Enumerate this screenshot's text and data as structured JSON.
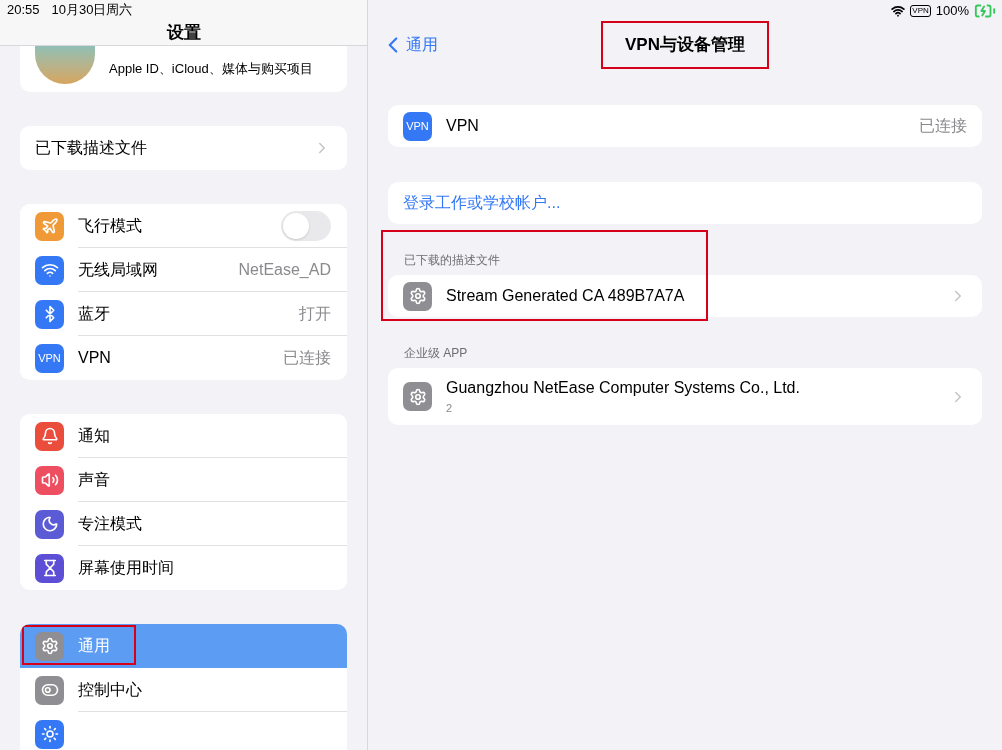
{
  "status_bar": {
    "time": "20:55",
    "date": "10月30日周六",
    "vpn": "VPN",
    "battery": "100%"
  },
  "sidebar": {
    "title": "设置",
    "account": {
      "subtitle": "Apple ID、iCloud、媒体与购买项目"
    },
    "groups": [
      {
        "items": [
          {
            "kind": "link",
            "label": "已下载描述文件",
            "selected": false,
            "annotated": false
          }
        ]
      },
      {
        "items": [
          {
            "kind": "toggle",
            "label": "飞行模式",
            "on": false,
            "selected": false,
            "annotated": false
          },
          {
            "kind": "value",
            "label": "无线局域网",
            "value": "NetEase_AD",
            "selected": false,
            "annotated": false
          },
          {
            "kind": "value",
            "label": "蓝牙",
            "value": "打开",
            "selected": false,
            "annotated": false
          },
          {
            "kind": "value",
            "icon_text": "VPN",
            "label": "VPN",
            "value": "已连接",
            "selected": false,
            "annotated": false
          }
        ]
      },
      {
        "items": [
          {
            "kind": "plain",
            "label": "通知",
            "selected": false,
            "annotated": false
          },
          {
            "kind": "plain",
            "label": "声音",
            "selected": false,
            "annotated": false
          },
          {
            "kind": "plain",
            "label": "专注模式",
            "selected": false,
            "annotated": false
          },
          {
            "kind": "plain",
            "label": "屏幕使用时间",
            "selected": false,
            "annotated": false
          }
        ]
      },
      {
        "items": [
          {
            "kind": "plain",
            "label": "通用",
            "selected": true,
            "annotated": true
          },
          {
            "kind": "plain",
            "label": "控制中心",
            "selected": false,
            "annotated": false
          },
          {
            "kind": "cut",
            "selected": false,
            "annotated": false
          }
        ]
      }
    ]
  },
  "detail": {
    "back": "通用",
    "title": "VPN与设备管理",
    "title_annotated": true,
    "sections": [
      {
        "annotated": false,
        "rows": [
          {
            "icon_text": "VPN",
            "label": "VPN",
            "value": "已连接",
            "chevron": false,
            "kind": "value"
          }
        ]
      },
      {
        "annotated": false,
        "rows": [
          {
            "label": "登录工作或学校帐户...",
            "chevron": false,
            "kind": "link"
          }
        ]
      },
      {
        "header": "已下载的描述文件",
        "annotated": true,
        "rows": [
          {
            "label": "Stream Generated CA 489B7A7A",
            "chevron": true,
            "kind": "value"
          }
        ]
      },
      {
        "header": "企业级 APP",
        "annotated": false,
        "rows": [
          {
            "label": "Guangzhou NetEase Computer Systems Co., Ltd.",
            "sub": "2",
            "chevron": true,
            "kind": "value"
          }
        ]
      }
    ]
  }
}
